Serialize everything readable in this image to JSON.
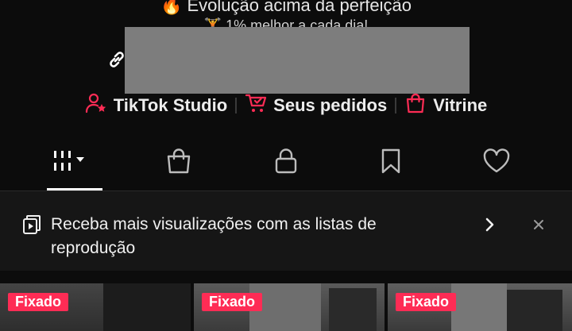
{
  "bio": {
    "line1": "🔥 Evolução acima da perfeição",
    "line2": "🏋 1% melhor a cada dia!"
  },
  "quick_links": [
    {
      "label": "TikTok Studio",
      "icon": "person-star-icon"
    },
    {
      "label": "Seus pedidos",
      "icon": "cart-check-icon"
    },
    {
      "label": "Vitrine",
      "icon": "shopping-bag-icon"
    }
  ],
  "tabs": [
    {
      "name": "videos-grid-tab",
      "icon": "grid-bars-dropdown-icon",
      "selected": true
    },
    {
      "name": "shop-tab",
      "icon": "shopping-bag-icon"
    },
    {
      "name": "private-tab",
      "icon": "lock-icon"
    },
    {
      "name": "saved-tab",
      "icon": "bookmark-icon"
    },
    {
      "name": "liked-tab",
      "icon": "heart-icon"
    }
  ],
  "banner": {
    "text": "Receba mais visualizações com as listas de reprodução"
  },
  "grid": {
    "pinned_label": "Fixado",
    "items": [
      {
        "pinned": "Fixado"
      },
      {
        "pinned": "Fixado"
      },
      {
        "pinned": "Fixado"
      }
    ]
  },
  "colors": {
    "accent": "#fe2c55",
    "background": "#0c0c0c"
  }
}
